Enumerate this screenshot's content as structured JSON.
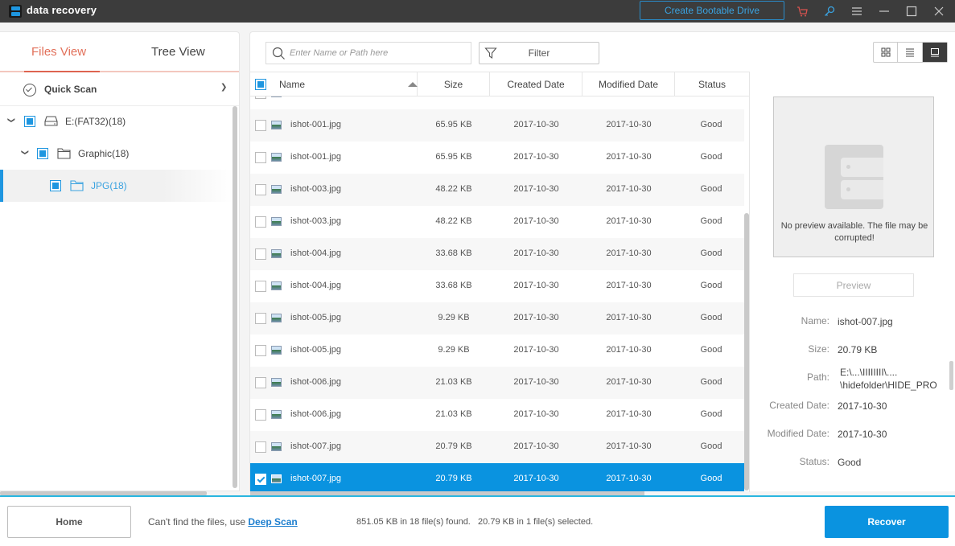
{
  "titlebar": {
    "app_title": "data recovery",
    "bootable_label": "Create Bootable Drive",
    "icons": [
      "cart-icon",
      "key-icon",
      "menu-icon",
      "minimize-icon",
      "maximize-icon",
      "close-icon"
    ]
  },
  "left": {
    "tabs": [
      {
        "label": "Files View",
        "active": true
      },
      {
        "label": "Tree View",
        "active": false
      }
    ],
    "scan_label": "Quick Scan",
    "tree": [
      {
        "label": "E:(FAT32)(18)",
        "icon": "drive-icon",
        "level": 0,
        "expanded": true
      },
      {
        "label": "Graphic(18)",
        "icon": "folder-icon",
        "level": 1,
        "expanded": true
      },
      {
        "label": "JPG(18)",
        "icon": "folder-icon",
        "level": 2,
        "active": true
      }
    ]
  },
  "toolbar": {
    "search_placeholder": "Enter Name or Path here",
    "search_value": "",
    "filter_label": "Filter",
    "view_modes": [
      "grid-view-icon",
      "list-view-icon",
      "preview-view-icon"
    ],
    "active_view": "preview-view-icon"
  },
  "table": {
    "columns": [
      "Name",
      "Size",
      "Created Date",
      "Modified Date",
      "Status"
    ],
    "sort_column": "Name",
    "sort_direction": "ascending",
    "rows": [
      {
        "name": "ishot-001.jpg",
        "size": "65.95 KB",
        "created": "2017-10-30",
        "modified": "2017-10-30",
        "status": "Good",
        "checked": false
      },
      {
        "name": "ishot-001.jpg",
        "size": "65.95 KB",
        "created": "2017-10-30",
        "modified": "2017-10-30",
        "status": "Good",
        "checked": false
      },
      {
        "name": "ishot-003.jpg",
        "size": "48.22 KB",
        "created": "2017-10-30",
        "modified": "2017-10-30",
        "status": "Good",
        "checked": false
      },
      {
        "name": "ishot-003.jpg",
        "size": "48.22 KB",
        "created": "2017-10-30",
        "modified": "2017-10-30",
        "status": "Good",
        "checked": false
      },
      {
        "name": "ishot-004.jpg",
        "size": "33.68 KB",
        "created": "2017-10-30",
        "modified": "2017-10-30",
        "status": "Good",
        "checked": false
      },
      {
        "name": "ishot-004.jpg",
        "size": "33.68 KB",
        "created": "2017-10-30",
        "modified": "2017-10-30",
        "status": "Good",
        "checked": false
      },
      {
        "name": "ishot-005.jpg",
        "size": "9.29 KB",
        "created": "2017-10-30",
        "modified": "2017-10-30",
        "status": "Good",
        "checked": false
      },
      {
        "name": "ishot-005.jpg",
        "size": "9.29 KB",
        "created": "2017-10-30",
        "modified": "2017-10-30",
        "status": "Good",
        "checked": false
      },
      {
        "name": "ishot-006.jpg",
        "size": "21.03 KB",
        "created": "2017-10-30",
        "modified": "2017-10-30",
        "status": "Good",
        "checked": false
      },
      {
        "name": "ishot-006.jpg",
        "size": "21.03 KB",
        "created": "2017-10-30",
        "modified": "2017-10-30",
        "status": "Good",
        "checked": false
      },
      {
        "name": "ishot-007.jpg",
        "size": "20.79 KB",
        "created": "2017-10-30",
        "modified": "2017-10-30",
        "status": "Good",
        "checked": false
      },
      {
        "name": "ishot-007.jpg",
        "size": "20.79 KB",
        "created": "2017-10-30",
        "modified": "2017-10-30",
        "status": "Good",
        "checked": true,
        "selected": true
      }
    ]
  },
  "preview": {
    "message": "No preview available. The file may be corrupted!",
    "button_label": "Preview",
    "properties": [
      {
        "label": "Name:",
        "value": "ishot-007.jpg"
      },
      {
        "label": "Size:",
        "value": "20.79 KB"
      },
      {
        "label": "Path:",
        "value": "E:\\...\\IIIIIIII\\....\n\\hidefolder\\HIDE_PRO"
      },
      {
        "label": "Created Date:",
        "value": "2017-10-30"
      },
      {
        "label": "Modified Date:",
        "value": "2017-10-30"
      },
      {
        "label": "Status:",
        "value": "Good"
      }
    ]
  },
  "footer": {
    "home_label": "Home",
    "hint_text": "Can't find the files, use ",
    "deep_scan_label": "Deep Scan",
    "found_text": "851.05 KB in 18 file(s) found.",
    "selected_text": "20.79 KB in 1 file(s) selected.",
    "recover_label": "Recover"
  },
  "colors": {
    "accent": "#0a93e0",
    "tab_active": "#e2705a",
    "titlebar": "#3c3c3c"
  }
}
